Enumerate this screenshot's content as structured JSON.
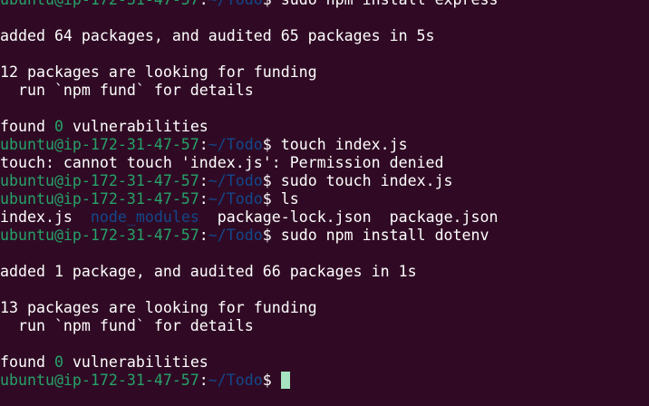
{
  "prompt": {
    "user_host": "ubuntu@ip-172-31-47-57",
    "colon": ":",
    "path": "~/Todo",
    "dollar": "$ "
  },
  "commands": {
    "install_express": "sudo npm install express",
    "touch": "touch index.js",
    "sudo_touch": "sudo touch index.js",
    "ls": "ls",
    "install_dotenv": "sudo npm install dotenv"
  },
  "output": {
    "added_express": "added 64 packages, and audited 65 packages in 5s",
    "funding_12": "12 packages are looking for funding",
    "fund_details": "  run `npm fund` for details",
    "found_prefix": "found ",
    "found_zero": "0",
    "found_suffix": " vulnerabilities",
    "touch_error": "touch: cannot touch 'index.js': Permission denied",
    "added_dotenv": "added 1 package, and audited 66 packages in 1s",
    "funding_13": "13 packages are looking for funding"
  },
  "ls_entries": {
    "index_js": "index.js",
    "node_modules": "node_modules",
    "package_lock": "package-lock.json",
    "package_json": "package.json"
  }
}
